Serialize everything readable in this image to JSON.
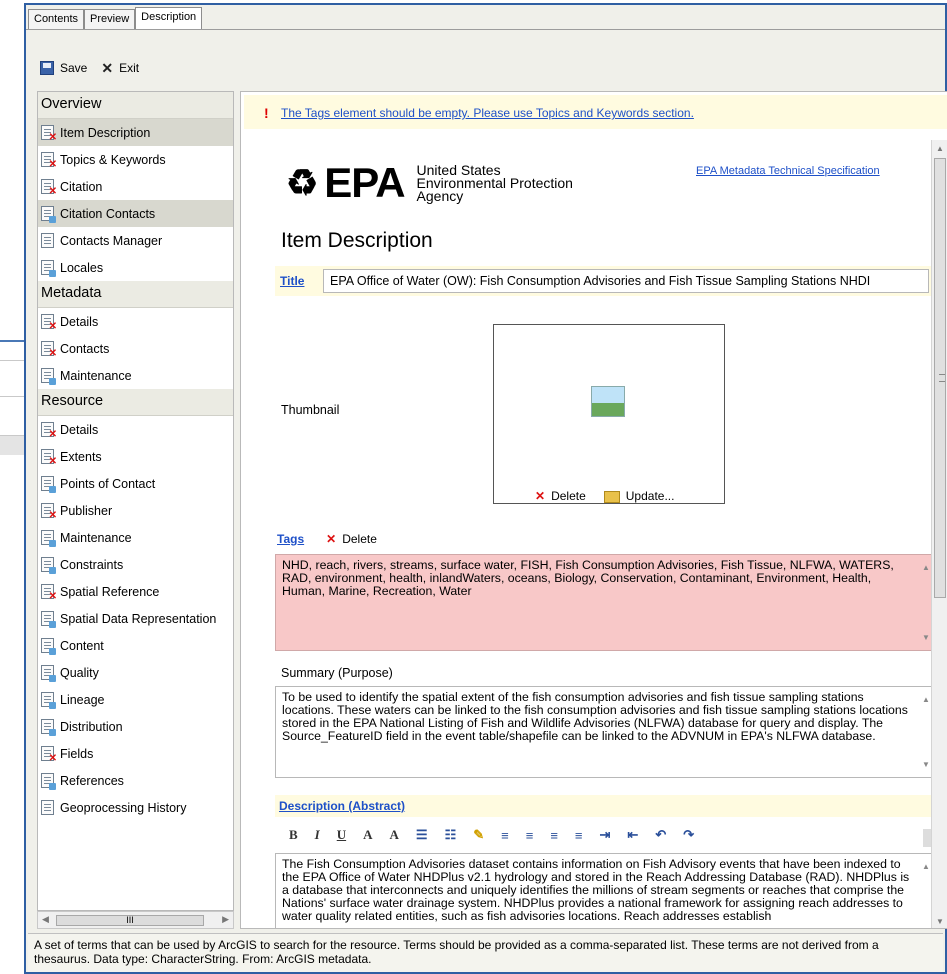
{
  "tabs": [
    "Contents",
    "Preview",
    "Description"
  ],
  "toolbar": {
    "save_label": "Save",
    "exit_label": "Exit"
  },
  "sidebar": {
    "overview": {
      "title": "Overview",
      "items": [
        {
          "label": "Item Description",
          "status": "error"
        },
        {
          "label": "Topics & Keywords",
          "status": "error"
        },
        {
          "label": "Citation",
          "status": "error"
        },
        {
          "label": "Citation Contacts",
          "status": "ok"
        },
        {
          "label": "Contacts Manager",
          "status": "none"
        },
        {
          "label": "Locales",
          "status": "ok"
        }
      ]
    },
    "metadata": {
      "title": "Metadata",
      "items": [
        {
          "label": "Details",
          "status": "error"
        },
        {
          "label": "Contacts",
          "status": "error"
        },
        {
          "label": "Maintenance",
          "status": "ok"
        }
      ]
    },
    "resource": {
      "title": "Resource",
      "items": [
        {
          "label": "Details",
          "status": "error"
        },
        {
          "label": "Extents",
          "status": "error"
        },
        {
          "label": "Points of Contact",
          "status": "ok"
        },
        {
          "label": "Publisher",
          "status": "error"
        },
        {
          "label": "Maintenance",
          "status": "ok"
        },
        {
          "label": "Constraints",
          "status": "ok"
        },
        {
          "label": "Spatial Reference",
          "status": "error"
        },
        {
          "label": "Spatial Data Representation",
          "status": "ok"
        },
        {
          "label": "Content",
          "status": "ok"
        },
        {
          "label": "Quality",
          "status": "ok"
        },
        {
          "label": "Lineage",
          "status": "ok"
        },
        {
          "label": "Distribution",
          "status": "ok"
        },
        {
          "label": "Fields",
          "status": "error"
        },
        {
          "label": "References",
          "status": "ok"
        },
        {
          "label": "Geoprocessing History",
          "status": "none"
        }
      ]
    },
    "hscroll_thumb": "III"
  },
  "main": {
    "warning": "The Tags element should be empty. Please use Topics and Keywords section.",
    "logo": {
      "word": "EPA",
      "line1": "United States",
      "line2": "Environmental Protection",
      "line3": "Agency"
    },
    "spec_link": "EPA Metadata Technical Specification",
    "page_title": "Item Description",
    "title_label": "Title",
    "title_value": "EPA Office of Water (OW): Fish Consumption Advisories and Fish Tissue Sampling Stations NHDI",
    "thumbnail_label": "Thumbnail",
    "thumb_delete": "Delete",
    "thumb_update": "Update...",
    "tags_label": "Tags",
    "tags_delete": "Delete",
    "tags_value": "NHD, reach, rivers, streams, surface water, FISH, Fish Consumption Advisories, Fish Tissue, NLFWA, WATERS, RAD, environment, health, inlandWaters, oceans, Biology, Conservation, Contaminant, Environment, Health, Human, Marine, Recreation, Water",
    "summary_label": "Summary (Purpose)",
    "summary_value": "To be used to identify the spatial extent of the fish consumption advisories and fish tissue sampling stations locations. These waters can be linked to the fish consumption advisories and fish tissue sampling stations locations stored in the EPA National Listing of Fish and Wildlife Advisories (NLFWA) database for query and display. The Source_FeatureID field in the event table/shapefile can be linked to the ADVNUM in EPA's NLFWA database.",
    "description_label": "Description (Abstract)",
    "rte_buttons": [
      "B",
      "I",
      "U",
      "A",
      "A"
    ],
    "description_value": "The Fish Consumption Advisories dataset contains information on Fish Advisory events that have been indexed to the EPA Office of Water NHDPlus v2.1 hydrology and stored in the Reach Addressing Database (RAD). NHDPlus is a database that interconnects and uniquely identifies the millions of stream segments or reaches that comprise the Nations' surface water drainage system. NHDPlus provides a national framework for assigning reach addresses to water quality related entities, such as fish advisories locations. Reach addresses establish"
  },
  "status_text": "A set of terms that can be used by ArcGIS to search for the resource. Terms should be provided as a comma-separated list. These terms are not derived from a thesaurus. Data type: CharacterString. From: ArcGIS metadata."
}
